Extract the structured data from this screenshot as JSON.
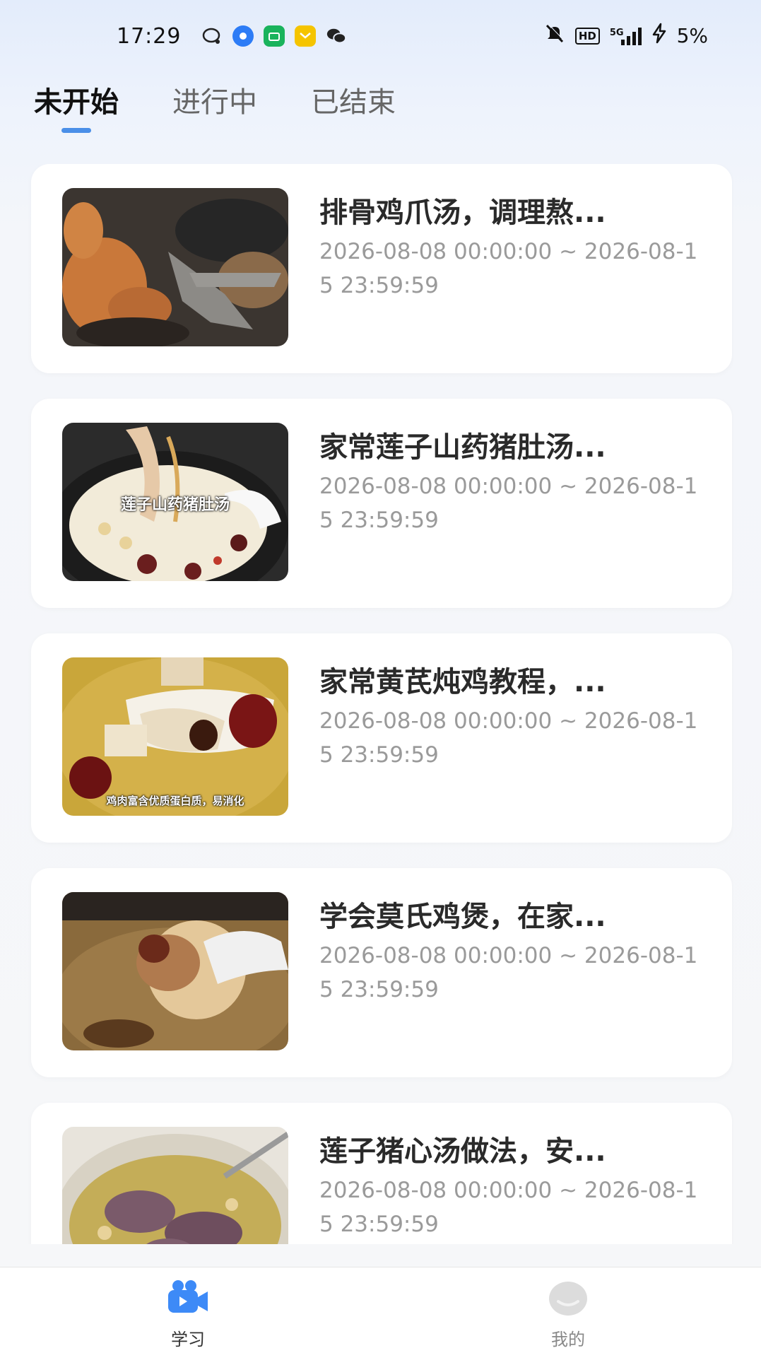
{
  "status_bar": {
    "time": "17:29",
    "network": "5G",
    "hd": "HD",
    "battery": "5%"
  },
  "tabs": [
    {
      "label": "未开始",
      "active": true
    },
    {
      "label": "进行中",
      "active": false
    },
    {
      "label": "已结束",
      "active": false
    }
  ],
  "courses": [
    {
      "title": "排骨鸡爪汤，调理熬...",
      "date": "2026-08-08 00:00:00 ~ 2026-08-15 23:59:59",
      "thumb_caption": ""
    },
    {
      "title": "家常莲子山药猪肚汤...",
      "date": "2026-08-08 00:00:00 ~ 2026-08-15 23:59:59",
      "thumb_caption": "莲子山药猪肚汤"
    },
    {
      "title": "家常黄芪炖鸡教程，...",
      "date": "2026-08-08 00:00:00 ~ 2026-08-15 23:59:59",
      "thumb_caption": "鸡肉富含优质蛋白质，易消化"
    },
    {
      "title": "学会莫氏鸡煲，在家...",
      "date": "2026-08-08 00:00:00 ~ 2026-08-15 23:59:59",
      "thumb_caption": ""
    },
    {
      "title": "莲子猪心汤做法，安...",
      "date": "2026-08-08 00:00:00 ~ 2026-08-15 23:59:59",
      "thumb_caption": ""
    }
  ],
  "bottom_nav": [
    {
      "label": "学习",
      "icon": "video-camera-icon",
      "active": true,
      "color": "#3d8af7"
    },
    {
      "label": "我的",
      "icon": "profile-icon",
      "active": false,
      "color": "#d9d9d9"
    }
  ]
}
